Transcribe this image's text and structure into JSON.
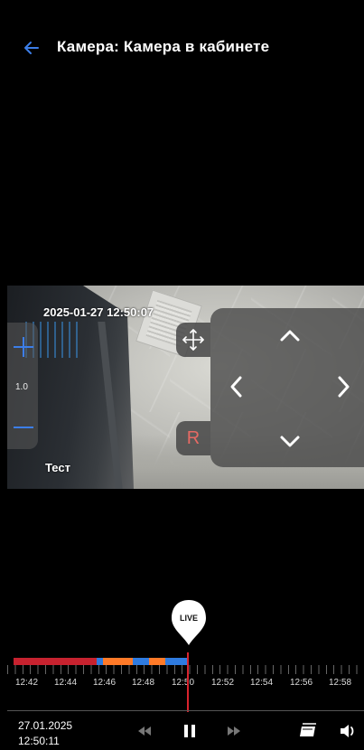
{
  "header": {
    "title": "Камера: Камера в кабинете",
    "back_icon": "arrow-left-icon",
    "accent": "#3c7ee8"
  },
  "video": {
    "osd_timestamp": "2025-01-27 12:50:07",
    "osd_camera_name": "Тест"
  },
  "zoom": {
    "level": "1.0",
    "plus_icon": "plus-icon",
    "minus_icon": "minus-icon"
  },
  "ptz": {
    "move_icon": "move-arrows-icon",
    "reset_label": "R",
    "reset_color": "#e66a64",
    "arrows": [
      "chevron-up-icon",
      "chevron-left-icon",
      "chevron-right-icon",
      "chevron-down-icon"
    ]
  },
  "live": {
    "label": "LIVE"
  },
  "timeline": {
    "tick_labels": [
      "12:42",
      "12:44",
      "12:46",
      "12:48",
      "12:50",
      "12:52",
      "12:54",
      "12:56",
      "12:58"
    ],
    "colors": {
      "continuous": "#c7222f",
      "motion": "#ff7a28",
      "event": "#2f7be0",
      "playhead": "#d9232d"
    },
    "segments": [
      {
        "from": "12:41:20",
        "to": "12:45:30",
        "type": "continuous"
      },
      {
        "from": "12:45:30",
        "to": "12:45:50",
        "type": "event"
      },
      {
        "from": "12:45:50",
        "to": "12:47:20",
        "type": "motion"
      },
      {
        "from": "12:47:20",
        "to": "12:48:10",
        "type": "event"
      },
      {
        "from": "12:48:10",
        "to": "12:49:00",
        "type": "motion"
      },
      {
        "from": "12:49:00",
        "to": "12:50:11",
        "type": "event"
      }
    ]
  },
  "bottom": {
    "date": "27.01.2025",
    "time": "12:50:11",
    "rewind_icon": "rewind-icon",
    "pause_icon": "pause-icon",
    "forward_icon": "fast-forward-icon",
    "calendar_icon": "calendar-icon",
    "volume_icon": "volume-icon"
  }
}
